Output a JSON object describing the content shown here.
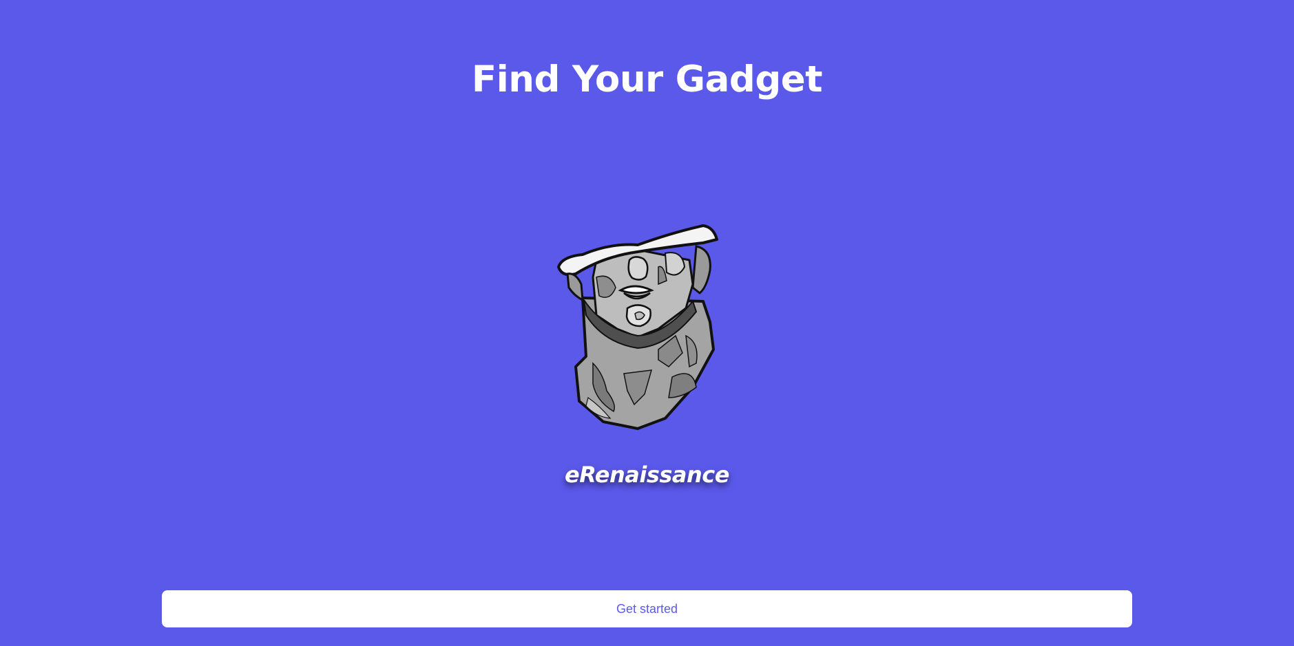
{
  "header": {
    "title": "Find Your Gadget"
  },
  "hero": {
    "image": "marble-bust-illustration",
    "brand_name": "eRenaissance"
  },
  "cta": {
    "label": "Get started"
  },
  "colors": {
    "background": "#5b59ea",
    "text": "#ffffff",
    "button_background": "#ffffff",
    "button_text": "#5b59ea"
  }
}
